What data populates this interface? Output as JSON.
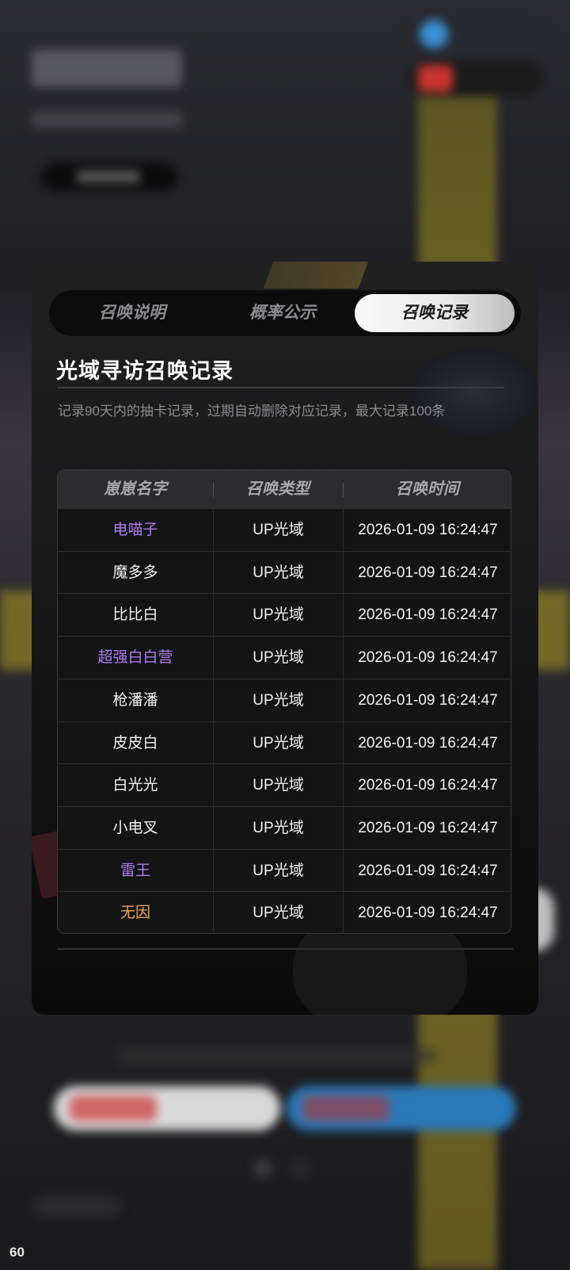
{
  "overlay": {
    "fps": "60"
  },
  "modal": {
    "tabs": [
      {
        "label": "召唤说明",
        "active": false
      },
      {
        "label": "概率公示",
        "active": false
      },
      {
        "label": "召唤记录",
        "active": true
      }
    ],
    "title": "光域寻访召唤记录",
    "description": "记录90天内的抽卡记录，过期自动删除对应记录，最大记录100条",
    "table": {
      "headers": [
        "崽崽名字",
        "召唤类型",
        "召唤时间"
      ],
      "rows": [
        {
          "name": "电喵子",
          "type": "UP光域",
          "time": "2026-01-09 16:24:47",
          "color": "#b07cf0"
        },
        {
          "name": "魔多多",
          "type": "UP光域",
          "time": "2026-01-09 16:24:47",
          "color": "#f2f2f2"
        },
        {
          "name": "比比白",
          "type": "UP光域",
          "time": "2026-01-09 16:24:47",
          "color": "#f2f2f2"
        },
        {
          "name": "超强白白营",
          "type": "UP光域",
          "time": "2026-01-09 16:24:47",
          "color": "#b07cf0"
        },
        {
          "name": "枪潘潘",
          "type": "UP光域",
          "time": "2026-01-09 16:24:47",
          "color": "#f2f2f2"
        },
        {
          "name": "皮皮白",
          "type": "UP光域",
          "time": "2026-01-09 16:24:47",
          "color": "#f2f2f2"
        },
        {
          "name": "白光光",
          "type": "UP光域",
          "time": "2026-01-09 16:24:47",
          "color": "#f2f2f2"
        },
        {
          "name": "小电叉",
          "type": "UP光域",
          "time": "2026-01-09 16:24:47",
          "color": "#f2f2f2"
        },
        {
          "name": "雷王",
          "type": "UP光域",
          "time": "2026-01-09 16:24:47",
          "color": "#b07cf0"
        },
        {
          "name": "无因",
          "type": "UP光域",
          "time": "2026-01-09 16:24:47",
          "color": "#f0a65a"
        }
      ]
    }
  }
}
